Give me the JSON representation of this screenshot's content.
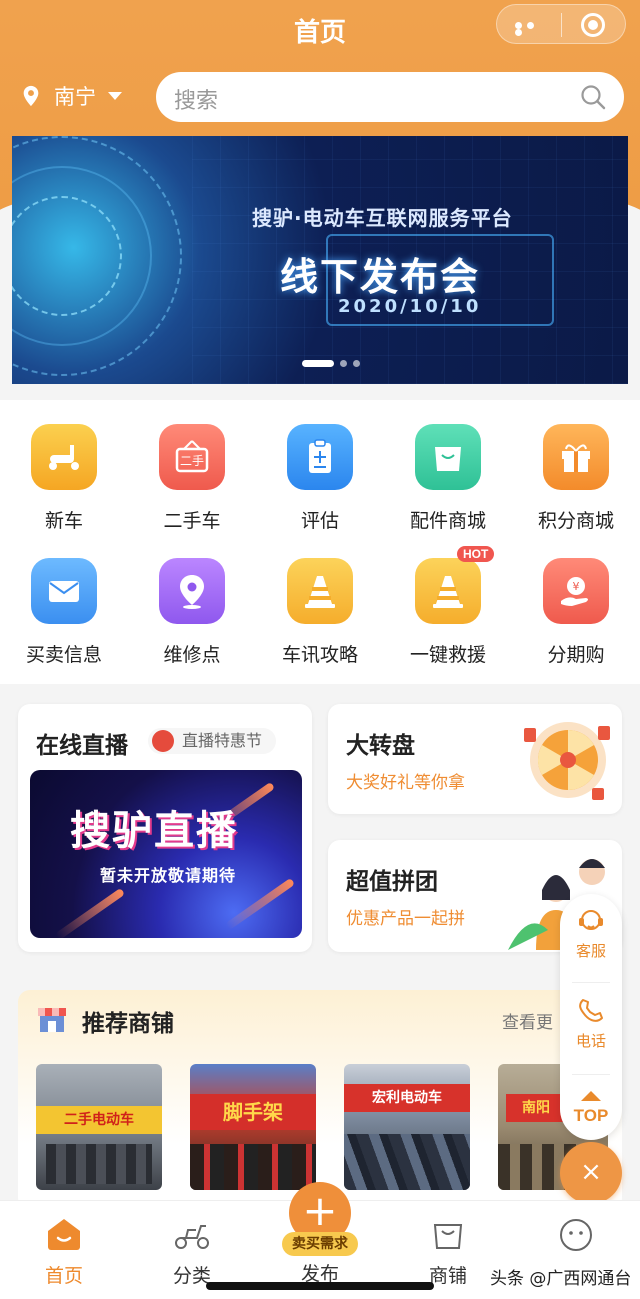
{
  "header": {
    "title": "首页",
    "city": "南宁",
    "search_placeholder": "搜索",
    "bg_color": "#ee9c44"
  },
  "banner": {
    "subtitle": "搜驴·电动车互联网服务平台",
    "title": "线下发布会",
    "date": "2020/10/10",
    "slide_count": 3,
    "active_slide": 1
  },
  "grid": [
    {
      "label": "新车",
      "icon": "scooter-icon",
      "color": "#f6b93a"
    },
    {
      "label": "二手车",
      "icon": "secondhand-sign-icon",
      "color": "#f0675a"
    },
    {
      "label": "评估",
      "icon": "clipboard-icon",
      "color": "#3d9af0"
    },
    {
      "label": "配件商城",
      "icon": "shopping-bag-icon",
      "color": "#3fcfa6"
    },
    {
      "label": "积分商城",
      "icon": "gift-icon",
      "color": "#f7a13c"
    },
    {
      "label": "买卖信息",
      "icon": "envelope-icon",
      "color": "#3d9af0"
    },
    {
      "label": "维修点",
      "icon": "location-pin-icon",
      "color": "#a36bf0"
    },
    {
      "label": "车讯攻略",
      "icon": "traffic-cone-icon",
      "color": "#f6b93a"
    },
    {
      "label": "一键救援",
      "icon": "traffic-cone-icon",
      "color": "#f6b93a",
      "badge": "HOT"
    },
    {
      "label": "分期购",
      "icon": "yuan-hand-icon",
      "color": "#f0675a"
    }
  ],
  "live": {
    "title": "在线直播",
    "badge": "直播特惠节",
    "image_title": "搜驴直播",
    "image_subtitle": "暂未开放敬请期待"
  },
  "wheel": {
    "title": "大转盘",
    "subtitle": "大奖好礼等你拿"
  },
  "group": {
    "title": "超值拼团",
    "subtitle": "优惠产品一起拼"
  },
  "shops": {
    "title": "推荐商铺",
    "more": "查看更",
    "items": [
      {
        "sign": "二手电动车",
        "sign_bg": "#f3c531",
        "sign_fg": "#d0211a",
        "bg": "#8a8f96"
      },
      {
        "sign": "脚手架",
        "sign_bg": "#d42f2a",
        "sign_fg": "#ffd84a",
        "bg": "#b03a2e"
      },
      {
        "sign": "宏利电动车",
        "sign_bg": "#d7322b",
        "sign_fg": "#ffffff",
        "bg": "#6c7d93"
      },
      {
        "sign": "南阳",
        "sign_bg": "#d7322b",
        "sign_fg": "#ffd84a",
        "bg": "#9a8a70"
      }
    ]
  },
  "float": {
    "service": "客服",
    "phone": "电话",
    "top": "TOP",
    "close": "×"
  },
  "tabs": [
    {
      "label": "首页",
      "icon": "home-icon",
      "active": true
    },
    {
      "label": "分类",
      "icon": "scooter-outline-icon",
      "active": false
    },
    {
      "label": "发布",
      "icon": "plus-icon",
      "active": false
    },
    {
      "label": "商铺",
      "icon": "bag-outline-icon",
      "active": false
    },
    {
      "label": "",
      "icon": "smiley-icon",
      "active": false
    }
  ],
  "publish_tag": "卖买需求",
  "watermark": "头条 @广西网通台"
}
